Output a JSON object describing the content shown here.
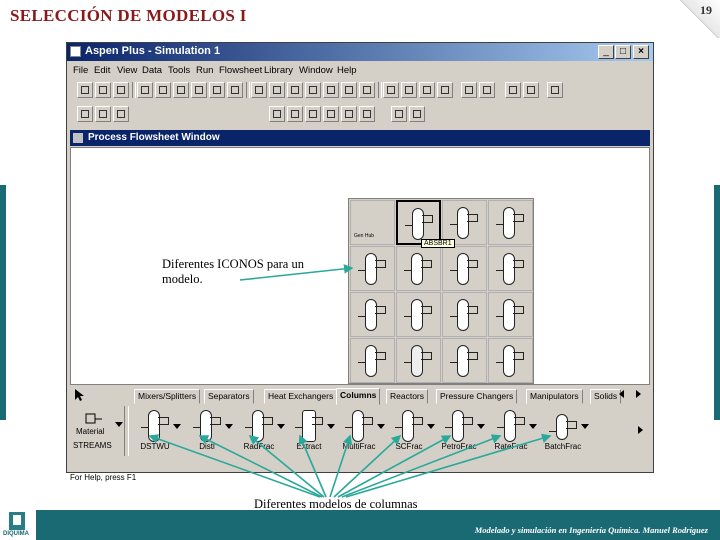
{
  "slide": {
    "title": "SELECCIÓN DE MODELOS I",
    "page_number": "19",
    "footer": "Modelado y simulación en Ingeniería Química.   Manuel Rodríguez",
    "logo_text": "DIQUIMA"
  },
  "window": {
    "title": "Aspen Plus - Simulation 1",
    "controls": [
      "_",
      "□",
      "×"
    ],
    "menu": [
      "File",
      "Edit",
      "View",
      "Data",
      "Tools",
      "Run",
      "Flowsheet",
      "Library",
      "Window",
      "Help"
    ],
    "subwindow_title": "Process Flowsheet Window"
  },
  "palette": {
    "tooltip": "ABSBR1",
    "first_cell_label": "Gen Hub"
  },
  "library": {
    "tabs": [
      "Mixers/Splitters",
      "Separators",
      "Heat Exchangers",
      "Columns",
      "Reactors",
      "Pressure Changers",
      "Manipulators",
      "Solids"
    ],
    "active_tab": "Columns",
    "stream_label": "Material",
    "stream_caption": "STREAMS",
    "models": [
      "DSTWU",
      "Distl",
      "RadFrac",
      "Extract",
      "MultiFrac",
      "SCFrac",
      "PetroFrac",
      "RateFrac",
      "BatchFrac"
    ],
    "status": "For Help, press F1"
  },
  "annotations": {
    "icons": "Diferentes ICONOS para un modelo.",
    "models": "Diferentes modelos de columnas"
  },
  "colors": {
    "accent": "#1a6a73",
    "title": "#8a1a1a",
    "titlebar": "#0a246a",
    "arrows": "#2aa89a"
  }
}
